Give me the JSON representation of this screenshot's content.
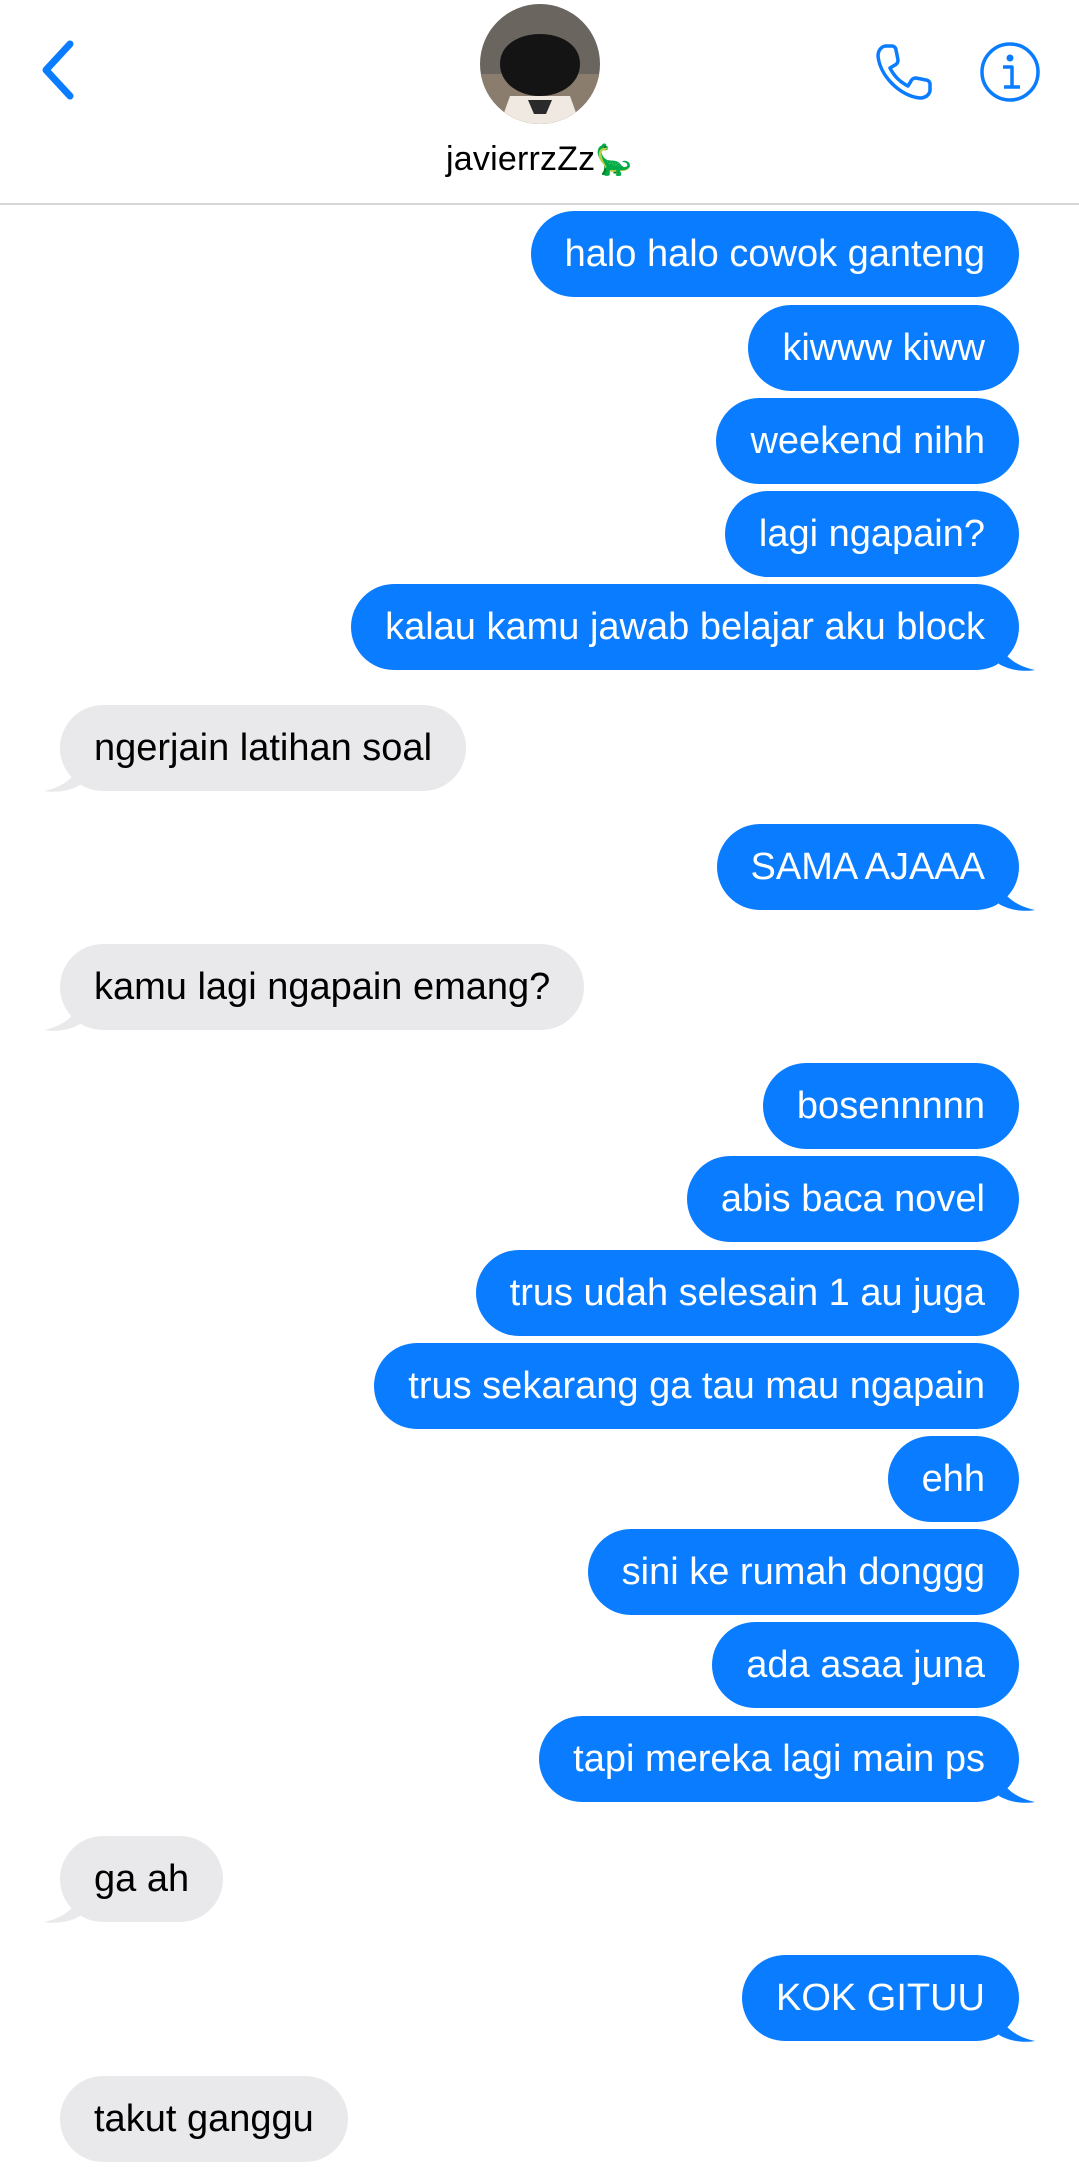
{
  "header": {
    "contact_name": "javierrzZz",
    "name_emoji": "🦕"
  },
  "colors": {
    "accent": "#0a7cff",
    "incoming_bubble": "#e9e9eb",
    "divider": "#d6d6d8"
  },
  "icons": {
    "back": "chevron-left-icon",
    "call": "phone-icon",
    "info": "info-icon"
  },
  "messages": [
    {
      "dir": "out",
      "text": "halo halo cowok ganteng"
    },
    {
      "dir": "out",
      "text": "kiwww kiww"
    },
    {
      "dir": "out",
      "text": "weekend nihh"
    },
    {
      "dir": "out",
      "text": "lagi ngapain?"
    },
    {
      "dir": "out",
      "text": "kalau kamu jawab belajar aku block"
    },
    {
      "dir": "in",
      "text": "ngerjain latihan soal"
    },
    {
      "dir": "out",
      "text": "SAMA AJAAA"
    },
    {
      "dir": "in",
      "text": "kamu lagi ngapain emang?"
    },
    {
      "dir": "out",
      "text": "bosennnnn"
    },
    {
      "dir": "out",
      "text": "abis baca novel"
    },
    {
      "dir": "out",
      "text": "trus udah selesain 1 au juga"
    },
    {
      "dir": "out",
      "text": "trus sekarang ga tau mau ngapain"
    },
    {
      "dir": "out",
      "text": "ehh"
    },
    {
      "dir": "out",
      "text": "sini ke rumah donggg"
    },
    {
      "dir": "out",
      "text": "ada asaa juna"
    },
    {
      "dir": "out",
      "text": "tapi mereka lagi main ps"
    },
    {
      "dir": "in",
      "text": "ga ah"
    },
    {
      "dir": "out",
      "text": "KOK GITUU"
    },
    {
      "dir": "in",
      "text": "takut ganggu"
    }
  ]
}
